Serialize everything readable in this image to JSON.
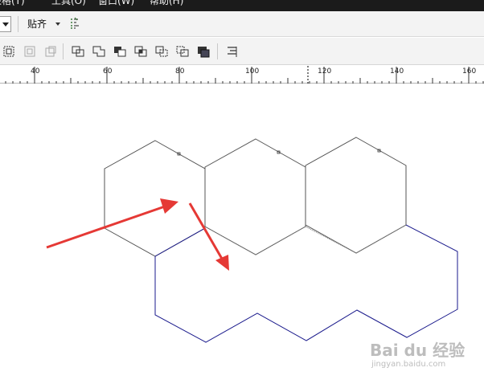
{
  "menu": {
    "items": [
      "表格(T)",
      "工具(O)",
      "窗口(W)",
      "帮助(H)"
    ]
  },
  "toolbar": {
    "snap_label": "贴齐"
  },
  "ruler": {
    "labels": [
      "40",
      "60",
      "80",
      "100",
      "120",
      "140",
      "160"
    ]
  },
  "watermark": {
    "logo_text": "Bai du 经验",
    "url": "jingyan.baidu.com"
  },
  "icons": [
    "dropdown-arrow-icon",
    "snap-dropdown-arrow-icon",
    "snap-to-icon",
    "group-objects-icon",
    "ungroup-objects-icon",
    "ungroup-all-icon",
    "combine-icon",
    "weld-icon",
    "trim-icon",
    "intersect-icon",
    "simplify-icon",
    "front-minus-back-icon",
    "back-minus-front-icon",
    "create-boundary-icon",
    "align-distribute-icon"
  ],
  "colors": {
    "menubar_bg": "#1b1b1b",
    "toolbar_bg": "#f3f3f3",
    "hexagon_stroke": "#555555",
    "boundary_stroke": "#1a1a8c",
    "arrow": "#e53935"
  }
}
